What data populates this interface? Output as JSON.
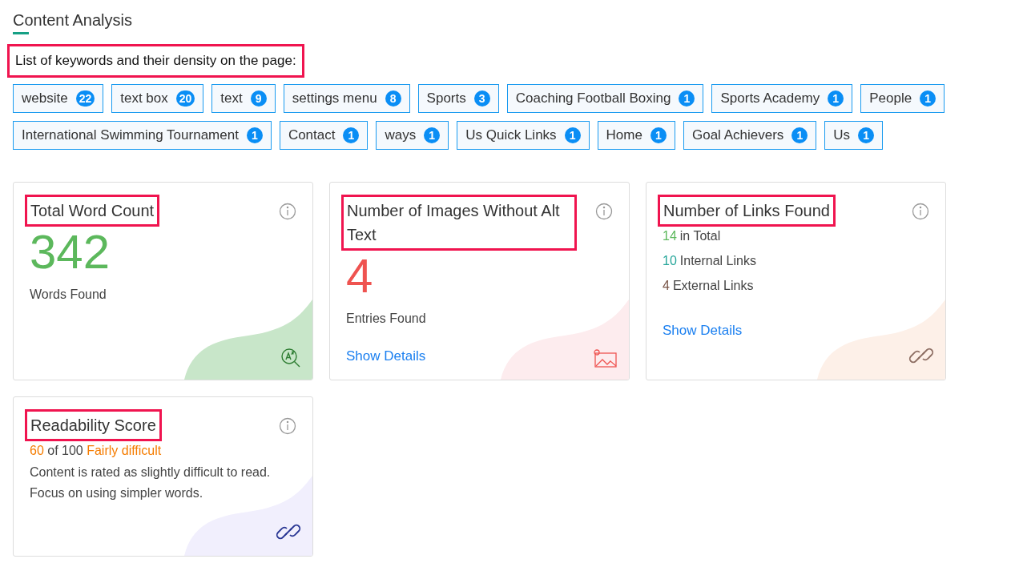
{
  "section": {
    "title": "Content Analysis"
  },
  "keywords_intro": {
    "text": "List of keywords and their density on the page:",
    "highlighted": true
  },
  "keyword_rows": [
    [
      {
        "label": "website",
        "count": "22"
      },
      {
        "label": "text box",
        "count": "20"
      },
      {
        "label": "text",
        "count": "9"
      },
      {
        "label": "settings menu",
        "count": "8"
      },
      {
        "label": "Sports",
        "count": "3"
      },
      {
        "label": "Coaching Football Boxing",
        "count": "1"
      },
      {
        "label": "Sports Academy",
        "count": "1"
      },
      {
        "label": "People",
        "count": "1"
      }
    ],
    [
      {
        "label": "International Swimming Tournament",
        "count": "1"
      },
      {
        "label": "Contact",
        "count": "1"
      },
      {
        "label": "ways",
        "count": "1"
      },
      {
        "label": "Us Quick Links",
        "count": "1"
      },
      {
        "label": "Home",
        "count": "1"
      },
      {
        "label": "Goal Achievers",
        "count": "1"
      },
      {
        "label": "Us",
        "count": "1"
      }
    ]
  ],
  "card_rows": [
    [
      {
        "kind": "words",
        "title": "Total Word Count",
        "highlighted": true,
        "value": "342",
        "color": "#5cb85c",
        "caption": "Words Found"
      },
      {
        "kind": "images",
        "title": "Number of Images Without Alt Text",
        "highlighted": true,
        "value": "4",
        "color": "#ef5350",
        "caption": "Entries Found",
        "link": "Show Details"
      },
      {
        "kind": "links",
        "title": "Number of Links Found",
        "highlighted": true,
        "stats": [
          {
            "value": "14",
            "label": "in Total",
            "color": "#5cb85c"
          },
          {
            "value": "10",
            "label": "Internal Links",
            "color": "#26a69a"
          },
          {
            "value": "4",
            "label": "External Links",
            "color": "#795548"
          }
        ],
        "link": "Show Details"
      }
    ],
    [
      {
        "kind": "readability",
        "title": "Readability Score",
        "highlighted": true,
        "score": "60",
        "scale": "of 100",
        "rating": "Fairly difficult",
        "color": "#f57c00",
        "lines": [
          "Content is rated as slightly difficult to read.",
          "Focus on using simpler words."
        ]
      }
    ]
  ]
}
